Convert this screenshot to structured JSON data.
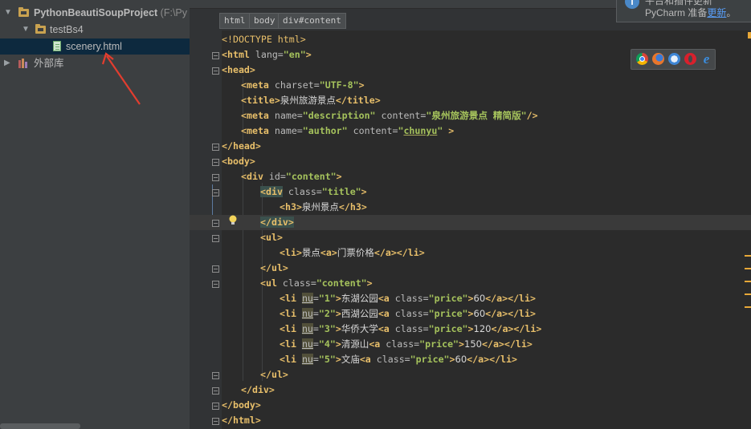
{
  "sidebar": {
    "project": {
      "name": "PythonBeautiSoupProject",
      "path": "(F:\\Py"
    },
    "folder": "testBs4",
    "file": "scenery.html",
    "external_libraries": "外部库"
  },
  "breadcrumb": [
    "html",
    "body",
    "div#content"
  ],
  "notification": {
    "title": "平台和插件更新",
    "body_prefix": "PyCharm 准备",
    "link": "更新",
    "body_suffix": "。"
  },
  "browser_icons": [
    "chrome-icon",
    "firefox-icon",
    "safari-icon",
    "opera-icon",
    "ie-icon"
  ],
  "colors": {
    "tag": "#e8bf6a",
    "attr": "#bababa",
    "value": "#a5c25c",
    "background": "#2b2b2b",
    "sidebar": "#3c3f41",
    "selection": "#0d293e",
    "arrow": "#e23d2f"
  },
  "code": {
    "l1": "<!DOCTYPE html>",
    "l2": {
      "open": "<html",
      "attr": " lang=",
      "val": "\"en\"",
      "close": ">"
    },
    "l3": "<head>",
    "l4": {
      "open": "<meta",
      "attr": " charset=",
      "val": "\"UTF-8\"",
      "close": ">"
    },
    "l5": {
      "open": "<title>",
      "text": "泉州旅游景点",
      "close": "</title>"
    },
    "l6": {
      "open": "<meta",
      "a1": " name=",
      "v1": "\"description\"",
      "a2": " content=",
      "v2": "\"泉州旅游景点 精简版\"",
      "close": "/>"
    },
    "l7": {
      "open": "<meta",
      "a1": " name=",
      "v1": "\"author\"",
      "a2": " content=",
      "v2a": "\"",
      "v2b": "chunyu",
      "v2c": "\"",
      "close": " >"
    },
    "l8": "</head>",
    "l9": "<body>",
    "l10": {
      "open": "<div",
      "attr": " id=",
      "val": "\"content\"",
      "close": ">"
    },
    "l11": {
      "open": "<div",
      "attr": " class=",
      "val": "\"title\"",
      "close": ">"
    },
    "l12": {
      "open": "<h3>",
      "text": "泉州景点",
      "close": "</h3>"
    },
    "l13": "</div>",
    "l14": "<ul>",
    "l15": {
      "o1": "<li>",
      "t1": "景点",
      "o2": "<a>",
      "t2": "门票价格",
      "c2": "</a>",
      "c1": "</li>"
    },
    "l16": "</ul>",
    "l17": {
      "open": "<ul",
      "attr": " class=",
      "val": "\"content\"",
      "close": ">"
    },
    "items": [
      {
        "nu": "\"1\"",
        "name": "东湖公园",
        "price": "60"
      },
      {
        "nu": "\"2\"",
        "name": "西湖公园",
        "price": "60"
      },
      {
        "nu": "\"3\"",
        "name": "华侨大学",
        "price": "120"
      },
      {
        "nu": "\"4\"",
        "name": "清源山",
        "price": "150"
      },
      {
        "nu": "\"5\"",
        "name": "文庙",
        "price": "60"
      }
    ],
    "li_parts": {
      "open": "<li",
      "nu_attr": "nu",
      "eq": "=",
      "gt": ">",
      "a_open": "<a",
      "class_attr": " class=",
      "class_val": "\"price\"",
      "a_close": "</a>",
      "li_close": "</li>"
    },
    "l23": "</ul>",
    "l24": "</div>",
    "l25": "</body>",
    "l26": "</html>"
  }
}
